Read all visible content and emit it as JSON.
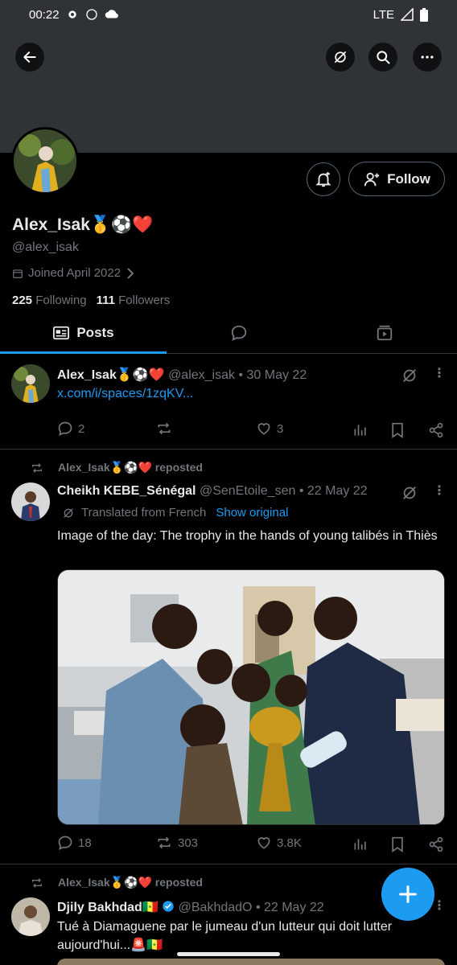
{
  "status": {
    "time": "00:22",
    "network": "LTE"
  },
  "profile": {
    "name": "Alex_Isak🥇⚽❤️",
    "handle": "@alex_isak",
    "joined": "Joined April 2022",
    "following_count": "225",
    "following_label": "Following",
    "followers_count": "111",
    "followers_label": "Followers",
    "follow_label": "Follow"
  },
  "tabs": {
    "posts": "Posts"
  },
  "posts": [
    {
      "author": "Alex_Isak🥇⚽❤️",
      "handle_date": "@alex_isak • 30 May 22",
      "link": "x.com/i/spaces/1zqKV...",
      "replies": "2",
      "reposts": "",
      "likes": "3"
    },
    {
      "repost_label": "Alex_Isak🥇⚽❤️ reposted",
      "author": "Cheikh KEBE_Sénégal",
      "handle_date": "@SenEtoile_sen • 22 May 22",
      "translated": "Translated from French",
      "show_original": "Show original",
      "text": "Image of the day: The trophy in the hands of young talibés in Thiès",
      "replies": "18",
      "reposts": "303",
      "likes": "3.8K"
    },
    {
      "repost_label": "Alex_Isak🥇⚽❤️ reposted",
      "author": "Djily Bakhdad🇸🇳",
      "handle_date": "@BakhdadO • 22 May 22",
      "text": "Tué à Diamaguene par le jumeau d'un lutteur qui doit lutter aujourd'hui...🚨🇸🇳"
    }
  ],
  "colors": {
    "accent": "#1d9bf0",
    "muted": "#71767b",
    "border": "#2f3336"
  }
}
